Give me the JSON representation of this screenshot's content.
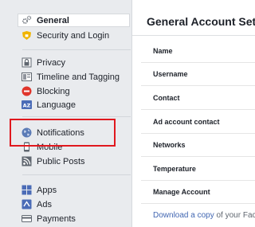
{
  "sidebar": {
    "items": [
      {
        "label": "General",
        "icon": "gears-icon"
      },
      {
        "label": "Security and Login",
        "icon": "shield-icon"
      },
      {
        "label": "Privacy",
        "icon": "lock-icon"
      },
      {
        "label": "Timeline and Tagging",
        "icon": "timeline-icon"
      },
      {
        "label": "Blocking",
        "icon": "block-icon"
      },
      {
        "label": "Language",
        "icon": "language-icon"
      },
      {
        "label": "Notifications",
        "icon": "globe-icon"
      },
      {
        "label": "Mobile",
        "icon": "mobile-icon"
      },
      {
        "label": "Public Posts",
        "icon": "rss-icon"
      },
      {
        "label": "Apps",
        "icon": "apps-icon"
      },
      {
        "label": "Ads",
        "icon": "ads-icon"
      },
      {
        "label": "Payments",
        "icon": "card-icon"
      }
    ]
  },
  "main": {
    "title": "General Account Settings",
    "rows": [
      {
        "label": "Name"
      },
      {
        "label": "Username"
      },
      {
        "label": "Contact"
      },
      {
        "label": "Ad account contact"
      },
      {
        "label": "Networks"
      },
      {
        "label": "Temperature"
      },
      {
        "label": "Manage Account"
      }
    ],
    "footer": {
      "link": "Download a copy",
      "rest": " of your Facebook data."
    }
  },
  "colors": {
    "accent": "#4267b2",
    "highlight": "#e0181e",
    "sidebar_bg": "#e9ebee"
  }
}
